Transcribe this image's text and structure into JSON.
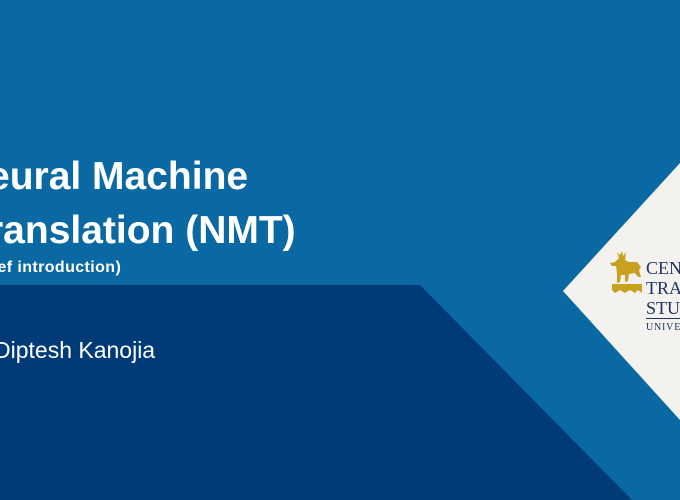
{
  "slide": {
    "title_line1": "eural Machine",
    "title_line2": "ranslation (NMT)",
    "subtitle": "rief introduction)",
    "author": "Diptesh Kanojia"
  },
  "logo": {
    "line1": "CEN",
    "line2": "TRA",
    "line3": "STU",
    "line4": "UNIVER"
  },
  "colors": {
    "background": "#0a69a3",
    "dark_panel": "#003b77",
    "logo_bg": "#f3f2ee",
    "logo_gold": "#c8a21e",
    "logo_navy": "#1d3461",
    "text": "#ffffff"
  },
  "icons": {
    "logo_emblem": "stag-icon"
  }
}
